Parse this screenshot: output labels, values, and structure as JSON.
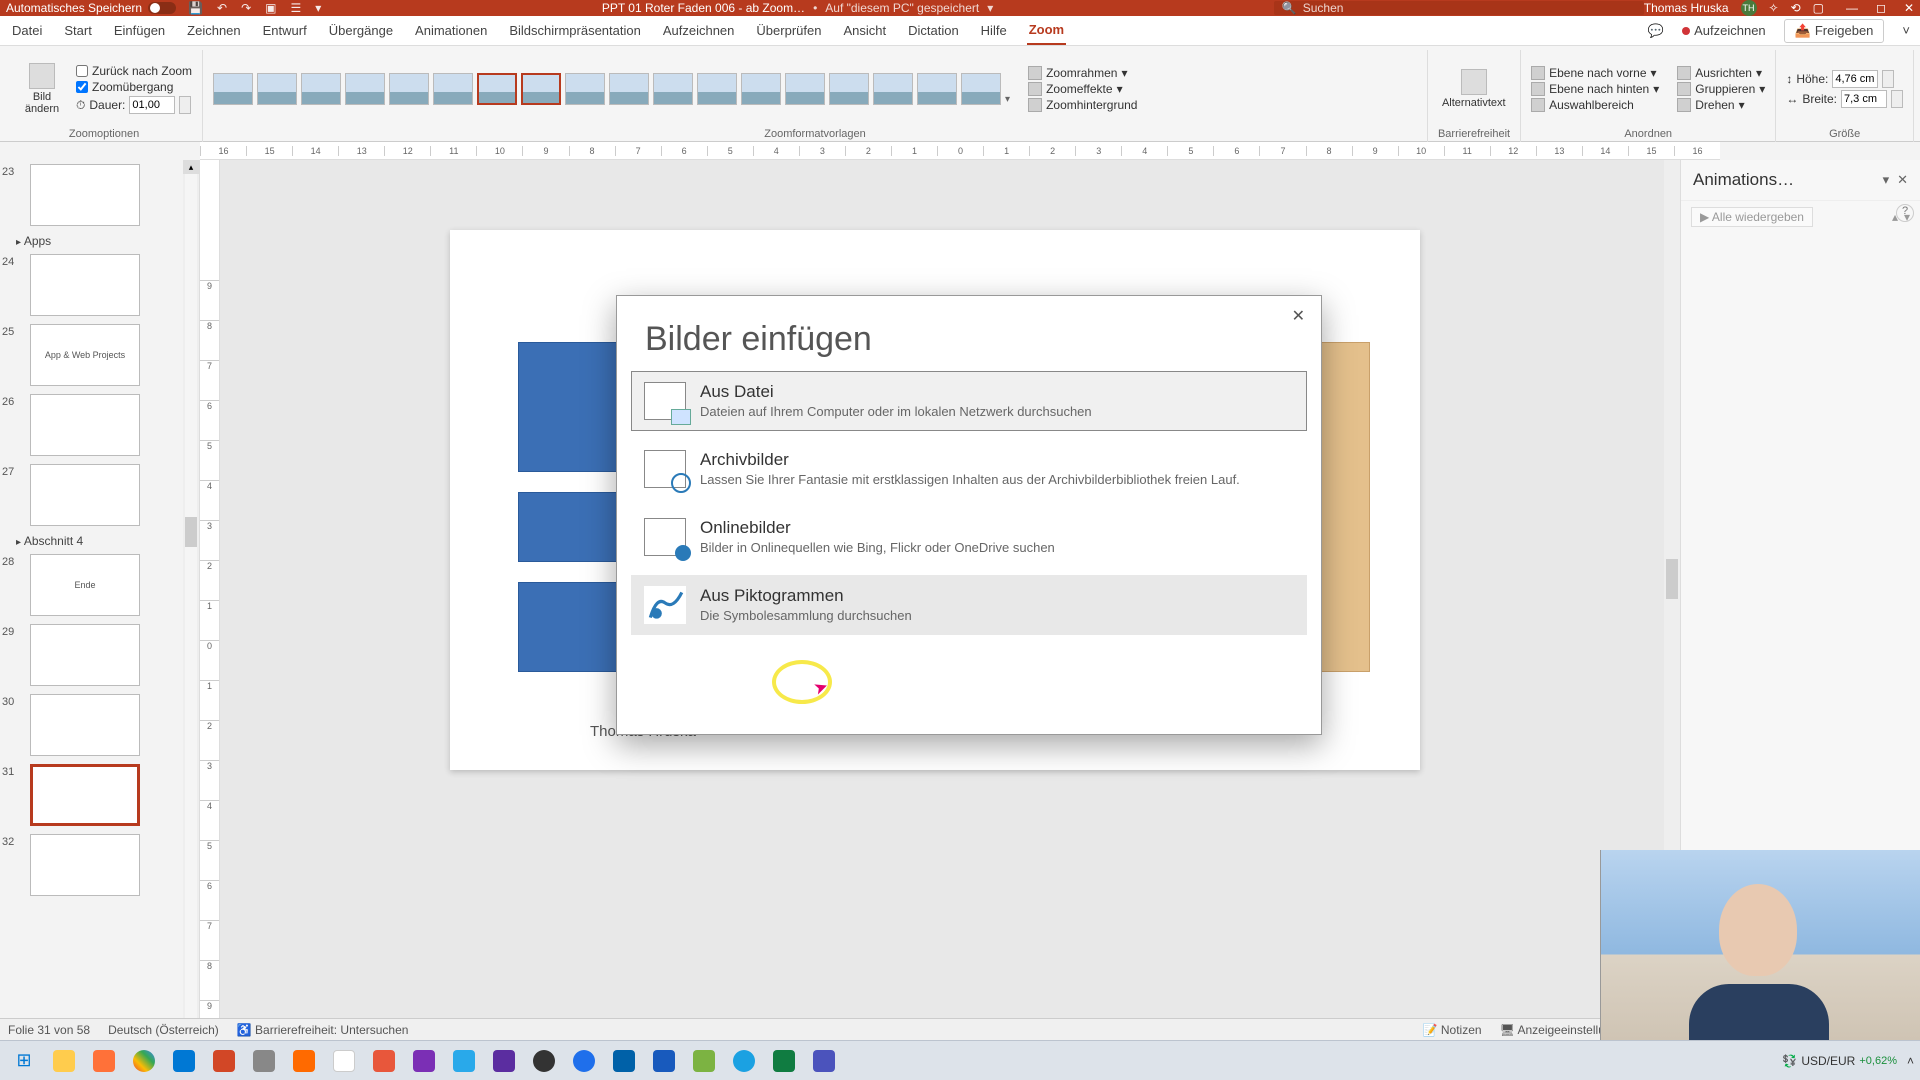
{
  "titlebar": {
    "autosave_label": "Automatisches Speichern",
    "doc_name": "PPT 01 Roter Faden 006 - ab Zoom…",
    "save_location": "Auf \"diesem PC\" gespeichert",
    "search_placeholder": "Suchen",
    "user_name": "Thomas Hruska",
    "user_initials": "TH"
  },
  "tabs": {
    "items": [
      "Datei",
      "Start",
      "Einfügen",
      "Zeichnen",
      "Entwurf",
      "Übergänge",
      "Animationen",
      "Bildschirmpräsentation",
      "Aufzeichnen",
      "Überprüfen",
      "Ansicht",
      "Dictation",
      "Hilfe",
      "Zoom"
    ],
    "active_index": 13,
    "record_label": "Aufzeichnen",
    "share_label": "Freigeben"
  },
  "ribbon": {
    "group_zoomoptions": {
      "label": "Zoomoptionen",
      "change_image": "Bild ändern",
      "return_to_zoom": "Zurück nach Zoom",
      "zoom_transition": "Zoomübergang",
      "duration_label": "Dauer:",
      "duration_value": "01,00"
    },
    "group_styles": {
      "label": "Zoomformatvorlagen"
    },
    "group_zoomcmds": {
      "zoomframe": "Zoomrahmen",
      "zoomeffects": "Zoomeffekte",
      "zoombackground": "Zoomhintergrund"
    },
    "group_alttext": {
      "label": "Barrierefreiheit",
      "btn": "Alternativtext"
    },
    "group_arrange": {
      "label": "Anordnen",
      "front": "Ebene nach vorne",
      "back": "Ebene nach hinten",
      "selection": "Auswahlbereich",
      "align": "Ausrichten",
      "group": "Gruppieren",
      "rotate": "Drehen"
    },
    "group_size": {
      "label": "Größe",
      "height_label": "Höhe:",
      "height_value": "4,76 cm",
      "width_label": "Breite:",
      "width_value": "7,3 cm"
    }
  },
  "ruler_h": [
    "16",
    "15",
    "14",
    "13",
    "12",
    "11",
    "10",
    "9",
    "8",
    "7",
    "6",
    "5",
    "4",
    "3",
    "2",
    "1",
    "0",
    "1",
    "2",
    "3",
    "4",
    "5",
    "6",
    "7",
    "8",
    "9",
    "10",
    "11",
    "12",
    "13",
    "14",
    "15",
    "16"
  ],
  "ruler_v": [
    "9",
    "8",
    "7",
    "6",
    "5",
    "4",
    "3",
    "2",
    "1",
    "0",
    "1",
    "2",
    "3",
    "4",
    "5",
    "6",
    "7",
    "8",
    "9"
  ],
  "thumbs": {
    "sections": [
      {
        "before_index": 24,
        "label": "Apps"
      },
      {
        "before_index": 28,
        "label": "Abschnitt 4"
      }
    ],
    "items": [
      {
        "n": 23,
        "caption": ""
      },
      {
        "n": 24,
        "caption": ""
      },
      {
        "n": 25,
        "caption": "App & Web Projects"
      },
      {
        "n": 26,
        "caption": ""
      },
      {
        "n": 27,
        "caption": ""
      },
      {
        "n": 28,
        "caption": "Ende"
      },
      {
        "n": 29,
        "caption": ""
      },
      {
        "n": 30,
        "caption": ""
      },
      {
        "n": 31,
        "caption": "",
        "selected": true
      },
      {
        "n": 32,
        "caption": ""
      }
    ]
  },
  "slide": {
    "author": "Thomas Hruska"
  },
  "anim_pane": {
    "title": "Animations…",
    "play_all": "Alle wiedergeben"
  },
  "dialog": {
    "title": "Bilder einfügen",
    "options": [
      {
        "key": "file",
        "title": "Aus Datei",
        "desc": "Dateien auf Ihrem Computer oder im lokalen Netzwerk durchsuchen",
        "selected": true
      },
      {
        "key": "stock",
        "title": "Archivbilder",
        "desc": "Lassen Sie Ihrer Fantasie mit erstklassigen Inhalten aus der Archivbilderbibliothek freien Lauf."
      },
      {
        "key": "online",
        "title": "Onlinebilder",
        "desc": "Bilder in Onlinequellen wie Bing, Flickr oder OneDrive suchen"
      },
      {
        "key": "picto",
        "title": "Aus Piktogrammen",
        "desc": "Die Symbolesammlung durchsuchen",
        "hover": true
      }
    ]
  },
  "statusbar": {
    "slide_of": "Folie 31 von 58",
    "language": "Deutsch (Österreich)",
    "accessibility": "Barrierefreiheit: Untersuchen",
    "notes": "Notizen",
    "display_settings": "Anzeigeeinstellungen"
  },
  "taskbar": {
    "currency_pair": "USD/EUR",
    "currency_change": "+0,62%"
  }
}
